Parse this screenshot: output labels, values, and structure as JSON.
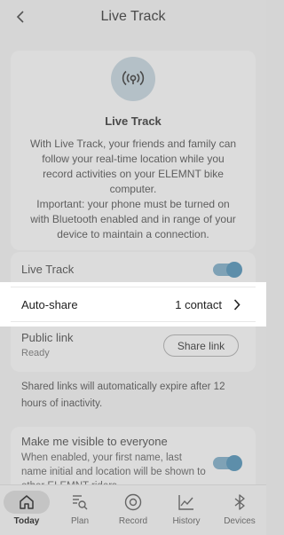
{
  "header": {
    "title": "Live Track"
  },
  "info_card": {
    "title": "Live Track",
    "description": "With Live Track, your friends and family can follow your real-time location while you record activities on your ELEMNT bike computer.",
    "note": "Important: your phone must be turned on with Bluetooth enabled and in range of your device to maintain a connection."
  },
  "settings": {
    "live_track_label": "Live Track",
    "live_track_on": true,
    "auto_share_label": "Auto-share",
    "auto_share_value": "1 contact",
    "public_link_label": "Public link",
    "public_link_status": "Ready",
    "share_link_button": "Share link"
  },
  "expiry_note": "Shared links will automatically expire after 12 hours of inactivity.",
  "visibility": {
    "title": "Make me visible to everyone",
    "description": "When enabled, your first name, last name initial and location will be shown to other ELEMNT riders",
    "enabled": true
  },
  "nav": {
    "items": [
      {
        "label": "Today",
        "icon": "home-icon",
        "active": true
      },
      {
        "label": "Plan",
        "icon": "plan-search-icon",
        "active": false
      },
      {
        "label": "Record",
        "icon": "record-icon",
        "active": false
      },
      {
        "label": "History",
        "icon": "history-chart-icon",
        "active": false
      },
      {
        "label": "Devices",
        "icon": "bluetooth-icon",
        "active": false
      }
    ]
  },
  "colors": {
    "overlay_gray": "#d6d6d6",
    "toggle_accent": "#5d8eaa",
    "highlight": "#ffffff"
  }
}
